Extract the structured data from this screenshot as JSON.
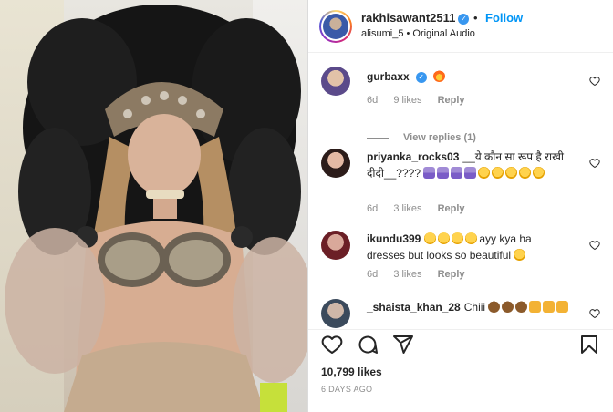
{
  "post": {
    "username": "rakhisawant2511",
    "verified_mark": "✓",
    "separator": "•",
    "follow_label": "Follow",
    "audio_line": "alisumi_5 • Original Audio"
  },
  "comments": [
    {
      "username": "gurbaxx",
      "verified": true,
      "text": "",
      "emojis": [
        "fire"
      ],
      "age": "6d",
      "likes": "9 likes",
      "reply": "Reply",
      "view_replies": "View replies (1)"
    },
    {
      "username": "priyanka_rocks03",
      "verified": false,
      "text": "__ये कौन सा रूप है राखी दीदी__????",
      "emojis": [
        "person-gesturing",
        "person-gesturing",
        "person-gesturing",
        "person-gesturing",
        "heart-eyes",
        "heart-eyes",
        "heart-eyes",
        "heart-eyes",
        "heart-eyes"
      ],
      "age": "6d",
      "likes": "3 likes",
      "reply": "Reply"
    },
    {
      "username": "ikundu399",
      "verified": false,
      "text": "ayy kya ha dresses but looks so beautiful",
      "emojis": [
        "laughing",
        "laughing",
        "laughing",
        "laughing",
        "heart-eyes"
      ],
      "age": "6d",
      "likes": "3 likes",
      "reply": "Reply"
    },
    {
      "username": "_shaista_khan_28",
      "verified": false,
      "text": "Chiii",
      "emojis": [
        "poop",
        "poop",
        "poop",
        "thumbs-down",
        "thumbs-down",
        "thumbs-down"
      ]
    }
  ],
  "footer": {
    "likes": "10,799 likes",
    "date": "6 DAYS AGO"
  },
  "icons": {
    "like": "heart-icon",
    "comment": "comment-icon",
    "share": "share-icon",
    "save": "bookmark-icon"
  },
  "colors": {
    "accent": "#0095f6",
    "verified": "#3897f0",
    "muted": "#8e8e8e",
    "text": "#262626"
  }
}
